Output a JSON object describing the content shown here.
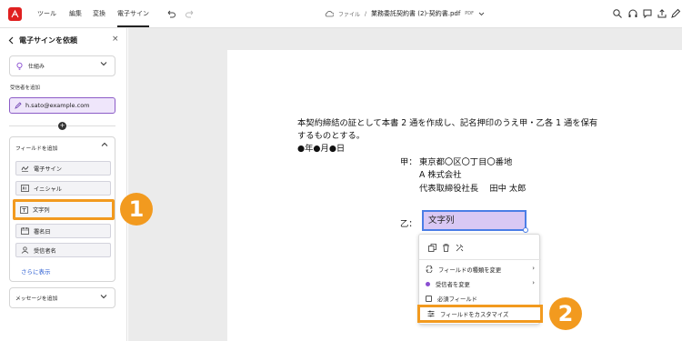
{
  "topbar": {
    "menu": [
      "ツール",
      "編集",
      "変換",
      "電子サイン"
    ],
    "active_menu": "電子サイン",
    "file_label": "ファイル",
    "separator": "/",
    "doc_name": "業務委託契約書 (2)-契約書.pdf",
    "doc_badge": "PDF"
  },
  "panel": {
    "title": "電子サインを依頼",
    "dropdown_label": "仕組み",
    "recipients_label": "受信者を追加",
    "recipient_email": "h.sato@example.com",
    "fields_title": "フィールドを追加",
    "fields": [
      {
        "label": "電子サイン",
        "icon": "signature-icon"
      },
      {
        "label": "イニシャル",
        "icon": "initials-icon"
      },
      {
        "label": "文字列",
        "icon": "text-field-icon"
      },
      {
        "label": "署名日",
        "icon": "date-icon"
      },
      {
        "label": "受信者名",
        "icon": "person-icon"
      }
    ],
    "more_link": "さらに表示",
    "message_title": "メッセージを追加"
  },
  "document": {
    "line1": "本契約締結の証として本書 2 通を作成し、記名押印のうえ甲・乙各 1 通を保有",
    "line2": "するものとする。",
    "date_line": "●年●月●日",
    "party_a_label": "甲：",
    "party_a_address": "東京都〇区〇丁目〇番地",
    "party_a_company": "A 株式会社",
    "party_a_rep": "代表取締役社長　 田中 太郎",
    "party_b_label": "乙：",
    "field_value": "文字列"
  },
  "context_menu": {
    "items": [
      {
        "label": "フィールドの種類を変更",
        "has_arrow": true
      },
      {
        "label": "受信者を変更",
        "has_arrow": true
      },
      {
        "label": "必須フィールド",
        "has_arrow": false
      },
      {
        "label": "フィールドをカスタマイズ",
        "has_arrow": false
      }
    ]
  },
  "callouts": {
    "step1": "1",
    "step2": "2"
  },
  "colors": {
    "accent": "#f29a1f",
    "brand": "#e02020",
    "field_fill": "#d9c8f4",
    "link": "#2d5fd3"
  }
}
